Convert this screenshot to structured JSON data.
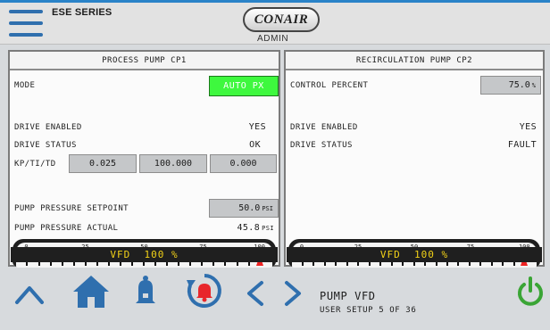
{
  "header": {
    "series": "ESE SERIES",
    "logo": "CONAIR",
    "role": "ADMIN"
  },
  "left_panel": {
    "title": "PROCESS PUMP CP1",
    "mode_label": "MODE",
    "mode_value": "AUTO PX",
    "drive_enabled_label": "DRIVE ENABLED",
    "drive_enabled_value": "YES",
    "drive_status_label": "DRIVE STATUS",
    "drive_status_value": "OK",
    "kp_label": "KP/TI/TD",
    "kp": "0.025",
    "ti": "100.000",
    "td": "0.000",
    "setpoint_label": "PUMP PRESSURE SETPOINT",
    "setpoint_value": "50.0",
    "setpoint_unit": "PSI",
    "actual_label": "PUMP PRESSURE ACTUAL",
    "actual_value": "45.8",
    "actual_unit": "PSI",
    "gauge_ticks": [
      "0",
      "25",
      "50",
      "75",
      "100"
    ],
    "gauge_level": 1.0,
    "vfd_label": "VFD",
    "vfd_value": "100 %"
  },
  "right_panel": {
    "title": "RECIRCULATION PUMP CP2",
    "control_label": "CONTROL PERCENT",
    "control_value": "75.0",
    "control_unit": "%",
    "drive_enabled_label": "DRIVE ENABLED",
    "drive_enabled_value": "YES",
    "drive_status_label": "DRIVE STATUS",
    "drive_status_value": "FAULT",
    "gauge_ticks": [
      "0",
      "25",
      "50",
      "75",
      "100"
    ],
    "gauge_level": 1.0,
    "vfd_label": "VFD",
    "vfd_value": "100 %"
  },
  "nav": {
    "screen_title": "PUMP VFD",
    "screen_subtitle": "USER SETUP 5 OF 36",
    "colors": {
      "icon_blue": "#2f6fae",
      "bell_red": "#e8262b",
      "power_green": "#3aa535",
      "mode_green": "#3ef83e",
      "vfd_yellow": "#f3d217"
    }
  }
}
